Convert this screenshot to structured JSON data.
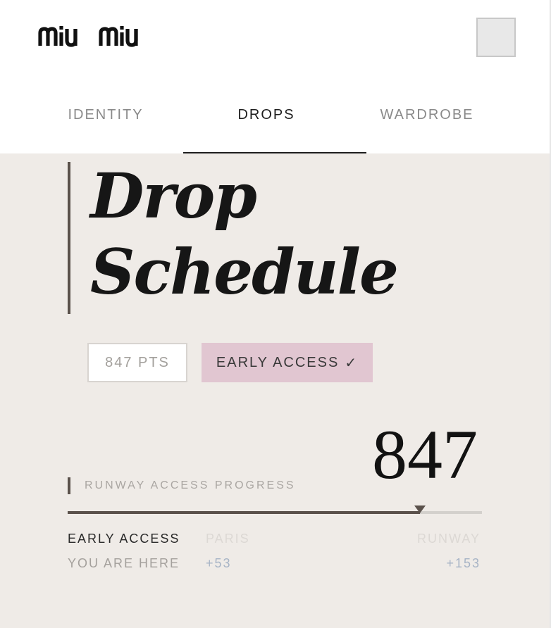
{
  "brand": {
    "logo_text": "miu miu"
  },
  "tabs": [
    {
      "label": "IDENTITY",
      "active": false
    },
    {
      "label": "DROPS",
      "active": true
    },
    {
      "label": "WARDROBE",
      "active": false
    }
  ],
  "page": {
    "title_line1": "Drop",
    "title_line2": "Schedule"
  },
  "badges": {
    "points": "847 PTS",
    "early_access": "EARLY ACCESS",
    "early_access_check": "✓"
  },
  "progress": {
    "label": "RUNWAY ACCESS PROGRESS",
    "value": "847",
    "fraction": 0.85,
    "current": {
      "label": "EARLY ACCESS",
      "sub": "YOU ARE HERE"
    },
    "next": {
      "label": "PARIS",
      "sub": "+53"
    },
    "final": {
      "label": "RUNWAY",
      "sub": "+153"
    }
  },
  "colors": {
    "background": "#efebe7",
    "accent_pink": "#e1c6d1",
    "bar_dark": "#5a514b",
    "muted_blue": "#a7b4c6"
  },
  "icons": {
    "menu": "menu-icon-placeholder"
  }
}
